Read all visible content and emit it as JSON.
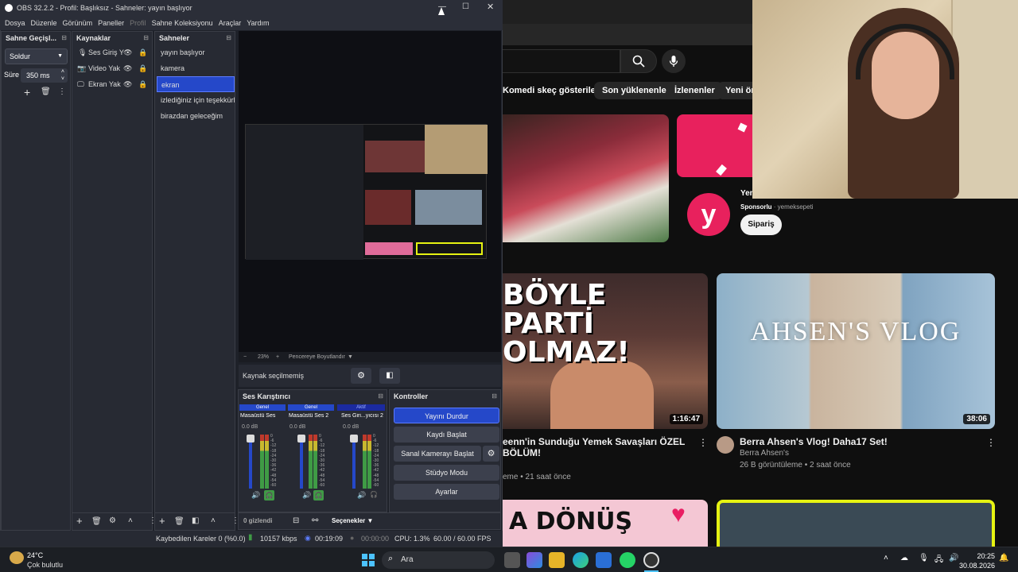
{
  "obs": {
    "title": "OBS 32.2.2 - Profil: Başlıksız - Sahneler: yayın başlıyor",
    "menu": [
      "Dosya",
      "Düzenle",
      "Görünüm",
      "Paneller",
      "Profil",
      "Sahne Koleksiyonu",
      "Araçlar",
      "Yardım"
    ],
    "transitions": {
      "header": "Sahne Geçişl...",
      "select": "Soldur",
      "duration_label": "Süre",
      "duration_value": "350 ms"
    },
    "sources": {
      "header": "Kaynaklar",
      "items": [
        "Ses Giriş Y",
        "Video Yak",
        "Ekran Yak"
      ]
    },
    "scenes": {
      "header": "Sahneler",
      "items": [
        "yayın başlıyor",
        "kamera",
        "ekran",
        "izlediğiniz için teşekkürl",
        "birazdan geleceğim"
      ],
      "selected_index": 2
    },
    "preview_bar": {
      "zoom": "23%",
      "fit": "Pencereye Boyutlandır"
    },
    "no_source": "Kaynak seçilmemiş",
    "mixer": {
      "header": "Ses Karıştırıcı",
      "channels": [
        {
          "tag": "Genel",
          "name": "Masaüstü Ses",
          "db": "0.0 dB"
        },
        {
          "tag": "Genel",
          "name": "Masaüstü Ses 2",
          "db": "0.0 dB"
        },
        {
          "tag": "Aktif",
          "name": "Ses Giri...yıcısı 2",
          "db": "0.0 dB"
        }
      ],
      "scale": [
        "0",
        "-6",
        "-12",
        "-18",
        "-24",
        "-30",
        "-36",
        "-42",
        "-48",
        "-54",
        "-60"
      ],
      "hidden": "0 gizlendi",
      "options": "Seçenekler"
    },
    "controls": {
      "header": "Kontroller",
      "stream": "Yayını Durdur",
      "record": "Kaydı Başlat",
      "virtualcam": "Sanal Kamerayı Başlat",
      "studio": "Stüdyo Modu",
      "settings": "Ayarlar"
    },
    "status": {
      "dropped": "Kaybedilen Kareler 0 (%0.0)",
      "bitrate": "10157 kbps",
      "stream_time": "00:19:09",
      "rec_time": "00:00:00",
      "cpu": "CPU: 1.3%",
      "fps": "60.00 / 60.00 FPS"
    }
  },
  "youtube": {
    "chips": [
      "Komedi skeç gösterileri",
      "Son yüklenenler",
      "İzlenenler",
      "Yeni öne"
    ],
    "ad": {
      "title": "Yen",
      "sponsored": "Sponsorlu",
      "advertiser": "yemeksepeti",
      "cta": "Sipariş"
    },
    "videos": [
      {
        "thumb_text": "BÖYLE PARTİ OLMAZ!",
        "duration": "1:16:47",
        "title": "eenn'in Sunduğu Yemek Savaşları ÖZEL BÖLÜM!",
        "channel": "",
        "meta": "eme • 21 saat önce"
      },
      {
        "thumb_text": "AHSEN'S VLOG",
        "duration": "38:06",
        "title": "Berra Ahsen's Vlog! Daha17 Set!",
        "channel": "Berra Ahsen's",
        "meta": "26 B görüntüleme • 2 saat önce"
      }
    ],
    "row2_thumb_text": "A DÖNÜŞ"
  },
  "taskbar": {
    "weather_temp": "24°C",
    "weather_desc": "Çok bulutlu",
    "search": "Ara",
    "time": "20:25",
    "date": "30.08.2026"
  }
}
